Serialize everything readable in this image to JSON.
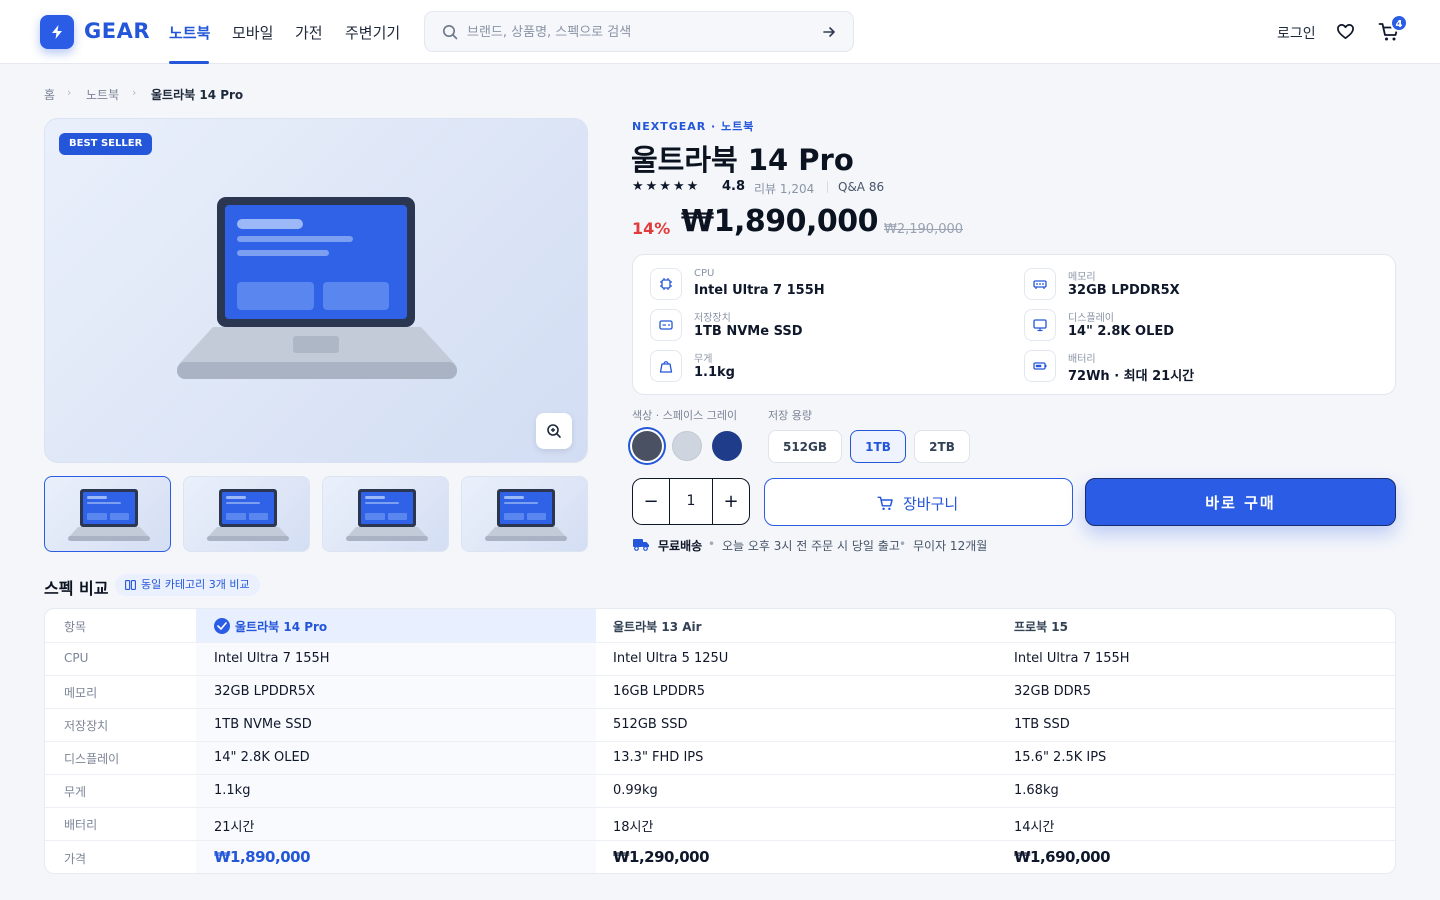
{
  "header": {
    "logo_text": "GEAR",
    "nav": [
      "노트북",
      "모바일",
      "가전",
      "주변기기"
    ],
    "active_nav": "노트북",
    "search_placeholder": "브랜드, 상품명, 스펙으로 검색",
    "login": "로그인",
    "cart_count": "4"
  },
  "breadcrumb": [
    "홈",
    "노트북",
    "울트라북 14 Pro"
  ],
  "gallery": {
    "badge": "BEST SELLER",
    "thumbnail_count": 4,
    "selected_thumbnail": 1
  },
  "product": {
    "brand_category": "NEXTGEAR · 노트북",
    "title": "울트라북 14 Pro",
    "stars": "★★★★★",
    "rating": "4.8",
    "reviews": "리뷰 1,204",
    "qa": "Q&A 86",
    "discount": "14%",
    "price": "₩1,890,000",
    "original_price": "₩2,190,000",
    "specs": [
      {
        "label": "CPU",
        "value": "Intel Ultra 7 155H",
        "icon": "cpu-icon"
      },
      {
        "label": "메모리",
        "value": "32GB LPDDR5X",
        "icon": "memory-icon"
      },
      {
        "label": "저장장치",
        "value": "1TB NVMe SSD",
        "icon": "storage-icon"
      },
      {
        "label": "디스플레이",
        "value": "14\" 2.8K OLED",
        "icon": "display-icon"
      },
      {
        "label": "무게",
        "value": "1.1kg",
        "icon": "weight-icon"
      },
      {
        "label": "배터리",
        "value": "72Wh · 최대 21시간",
        "icon": "battery-icon"
      }
    ],
    "color_label": "색상 · 스페이스 그레이",
    "colors": [
      "#4a5163",
      "#cfd5de",
      "#1f3c8a"
    ],
    "selected_color": 0,
    "storage_label": "저장 용량",
    "storage_options": [
      "512GB",
      "1TB",
      "2TB"
    ],
    "selected_storage": "1TB",
    "quantity": "1",
    "cart_button": "장바구니",
    "buy_button": "바로 구매",
    "shipping": {
      "free": "무료배송",
      "dispatch": "오늘 오후 3시 전 주문 시 당일 출고",
      "installment": "무이자 12개월"
    }
  },
  "compare": {
    "title": "스펙 비교",
    "badge": "동일 카테고리 3개 비교",
    "columns": [
      "항목",
      "울트라북 14 Pro",
      "울트라북 13 Air",
      "프로북 15"
    ],
    "rows": [
      [
        "CPU",
        "Intel Ultra 7 155H",
        "Intel Ultra 5 125U",
        "Intel Ultra 7 155H"
      ],
      [
        "메모리",
        "32GB LPDDR5X",
        "16GB LPDDR5",
        "32GB DDR5"
      ],
      [
        "저장장치",
        "1TB NVMe SSD",
        "512GB SSD",
        "1TB SSD"
      ],
      [
        "디스플레이",
        "14\" 2.8K OLED",
        "13.3\" FHD IPS",
        "15.6\" 2.5K IPS"
      ],
      [
        "무게",
        "1.1kg",
        "0.99kg",
        "1.68kg"
      ],
      [
        "배터리",
        "21시간",
        "18시간",
        "14시간"
      ],
      [
        "가격",
        "₩1,890,000",
        "₩1,290,000",
        "₩1,690,000"
      ]
    ]
  },
  "colors": {
    "accent": "#2356d8",
    "discount": "#e23b3b",
    "text": "#0f172a"
  }
}
